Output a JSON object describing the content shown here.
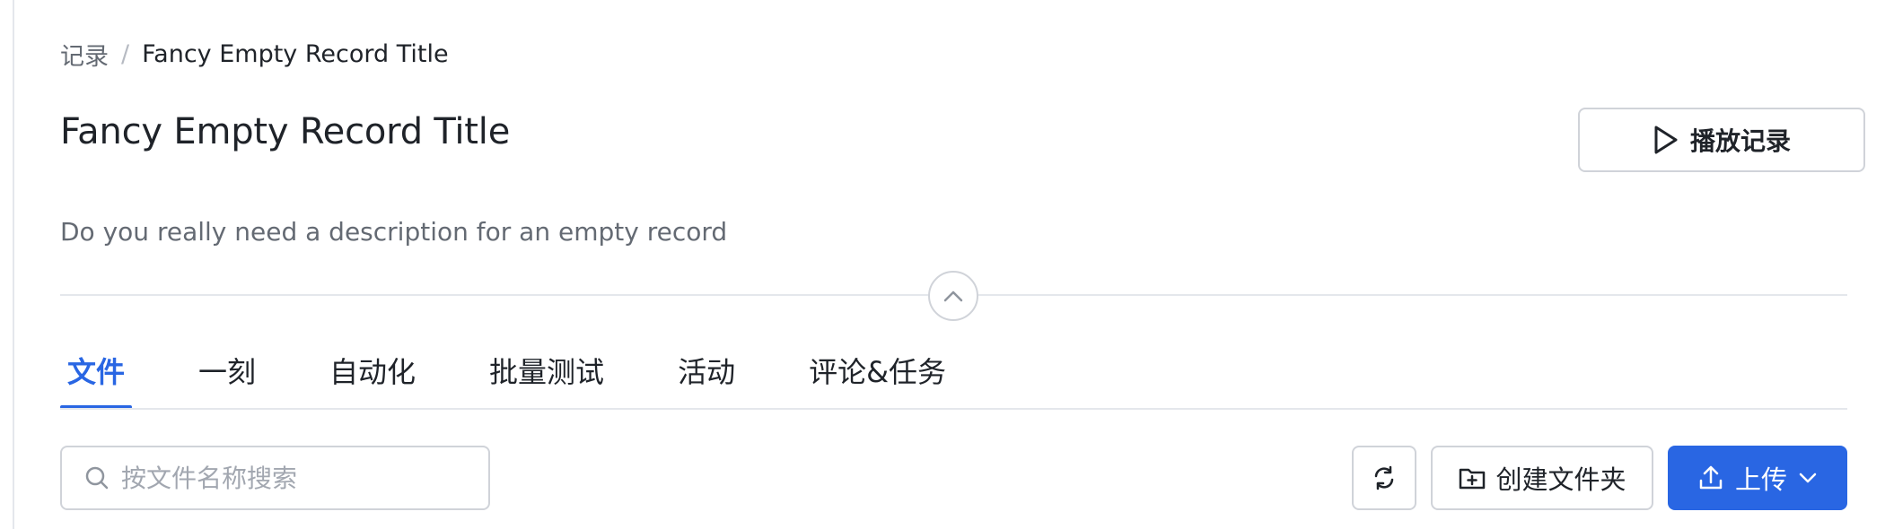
{
  "breadcrumb": {
    "parent": "记录",
    "separator": "/",
    "current": "Fancy Empty Record Title"
  },
  "record": {
    "title": "Fancy Empty Record Title",
    "description": "Do you really need a description for an empty record"
  },
  "header_actions": {
    "play_label": "播放记录",
    "play_icon": "play-icon"
  },
  "collapse_toggle": {
    "icon": "chevron-up-icon"
  },
  "tabs": [
    {
      "label": "文件",
      "active": true
    },
    {
      "label": "一刻",
      "active": false
    },
    {
      "label": "自动化",
      "active": false
    },
    {
      "label": "批量测试",
      "active": false
    },
    {
      "label": "活动",
      "active": false
    },
    {
      "label": "评论&任务",
      "active": false
    }
  ],
  "toolbar": {
    "search_placeholder": "按文件名称搜索",
    "search_value": "",
    "search_icon": "search-icon",
    "refresh_icon": "refresh-icon",
    "new_folder_icon": "folder-plus-icon",
    "new_folder_label": "创建文件夹",
    "upload_icon": "upload-icon",
    "upload_label": "上传",
    "upload_dropdown_icon": "chevron-down-icon"
  },
  "colors": {
    "accent": "#2966e3",
    "text_primary": "#1f2329",
    "text_secondary": "#646a73",
    "border": "#d0d3d9",
    "divider": "#e4e7ec"
  }
}
